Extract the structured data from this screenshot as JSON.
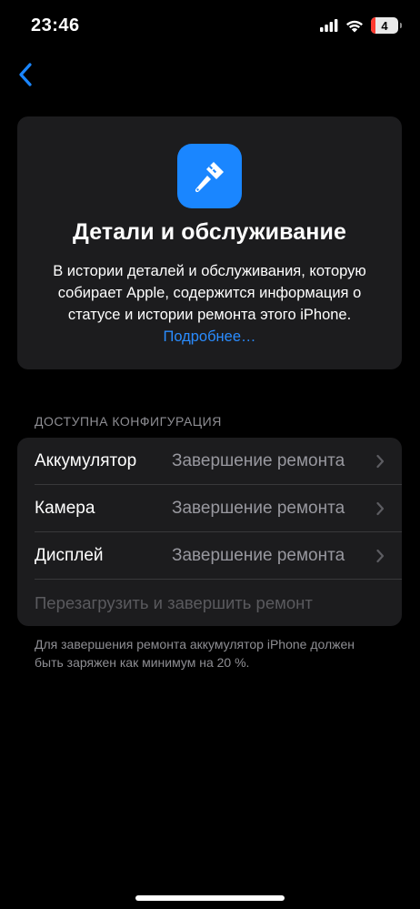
{
  "status_bar": {
    "time": "23:46",
    "battery_level": "4"
  },
  "header": {
    "title": "Детали и обслуживание",
    "description": "В истории деталей и обслуживания, которую собирает Apple, содержится информация о статусе и истории ремонта этого iPhone.",
    "learn_more": "Подробнее…"
  },
  "section": {
    "title": "ДОСТУПНА КОНФИГУРАЦИЯ",
    "rows": [
      {
        "label": "Аккумулятор",
        "value": "Завершение ремонта"
      },
      {
        "label": "Камера",
        "value": "Завершение ремонта"
      },
      {
        "label": "Дисплей",
        "value": "Завершение ремонта"
      }
    ],
    "action": "Перезагрузить и завершить ремонт"
  },
  "footer_note": "Для завершения ремонта аккумулятор iPhone должен быть заряжен как минимум на 20 %.",
  "colors": {
    "accent": "#1a86ff",
    "link": "#2a8cff",
    "card_bg": "#1c1c1e",
    "secondary_text": "#8e8e93",
    "battery_low": "#ff3b30"
  },
  "icons": {
    "back": "chevron-left-icon",
    "app": "screwdriver-icon",
    "row_disclosure": "chevron-right-icon"
  }
}
